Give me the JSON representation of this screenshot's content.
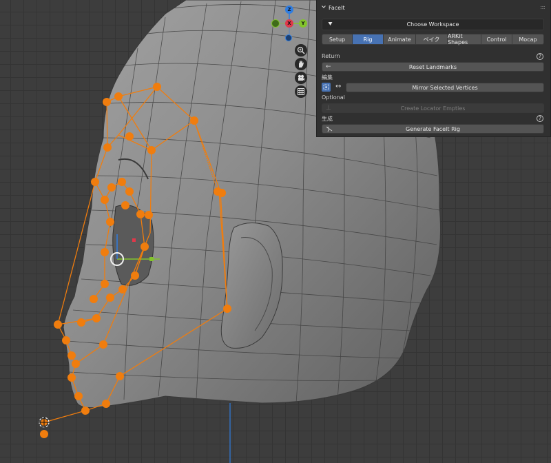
{
  "panel": {
    "title": "FaceIt",
    "choose_workspace": "Choose Workspace",
    "tabs": [
      {
        "label": "Setup",
        "active": false
      },
      {
        "label": "Rig",
        "active": true
      },
      {
        "label": "Animate",
        "active": false
      },
      {
        "label": "ベイク",
        "active": false
      },
      {
        "label": "ARKit Shapes",
        "active": false
      },
      {
        "label": "Control",
        "active": false
      },
      {
        "label": "Mocap",
        "active": false
      }
    ],
    "return_label": "Return",
    "reset_landmarks": "Reset Landmarks",
    "edit_label": "編集",
    "mirror_selected": "Mirror Selected Vertices",
    "optional_label": "Optional",
    "create_locator": "Create Locator Empties",
    "generate_label": "生成",
    "generate_rig": "Generate FaceIt Rig",
    "help_glyph": "?"
  },
  "gizmo": {
    "z_label": "Z",
    "y_label": "Y",
    "x_label": "X",
    "x_color": "#e0384a",
    "y_color": "#82c42c",
    "z_color": "#2f7de1"
  },
  "icons": {
    "collapse": "chevron-down-icon",
    "workspace": "triangle-down-icon",
    "back": "arrow-left-icon",
    "mirror": "double-arrow-icon",
    "zoom": "zoom-icon",
    "pan": "hand-icon",
    "camera": "camera-icon",
    "grid": "grid-icon"
  },
  "colors": {
    "landmark_orange": "#f07d0e",
    "active_tab": "#4772b3",
    "mesh_gray": "#8a8a8a"
  }
}
